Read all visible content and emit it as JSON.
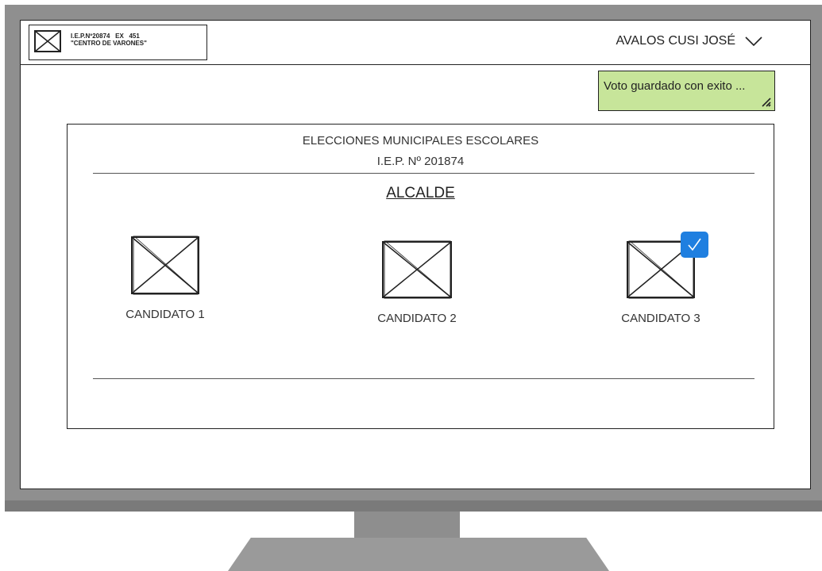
{
  "header": {
    "school_line1": "I.E.P.Nº20874   EX   451",
    "school_line2": "\"CENTRO DE VARONES\"",
    "user_name": "AVALOS CUSI JOSÉ"
  },
  "toast": {
    "message": "Voto guardado con exito ..."
  },
  "election": {
    "title": "ELECCIONES MUNICIPALES ESCOLARES",
    "school": "I.E.P. Nº 201874",
    "position": "ALCALDE"
  },
  "candidates": [
    {
      "label": "CANDIDATO 1",
      "selected": false
    },
    {
      "label": "CANDIDATO 2",
      "selected": false
    },
    {
      "label": "CANDIDATO 3",
      "selected": true
    }
  ],
  "icons": {
    "logo": "image-placeholder-icon",
    "user_menu": "chevron-down-icon",
    "toast_corner": "resize-handle-icon",
    "selected": "checkmark-icon"
  },
  "colors": {
    "toast_bg": "#c7e59a",
    "check_bg": "#1f7fe0",
    "monitor": "#8f8f8f"
  }
}
